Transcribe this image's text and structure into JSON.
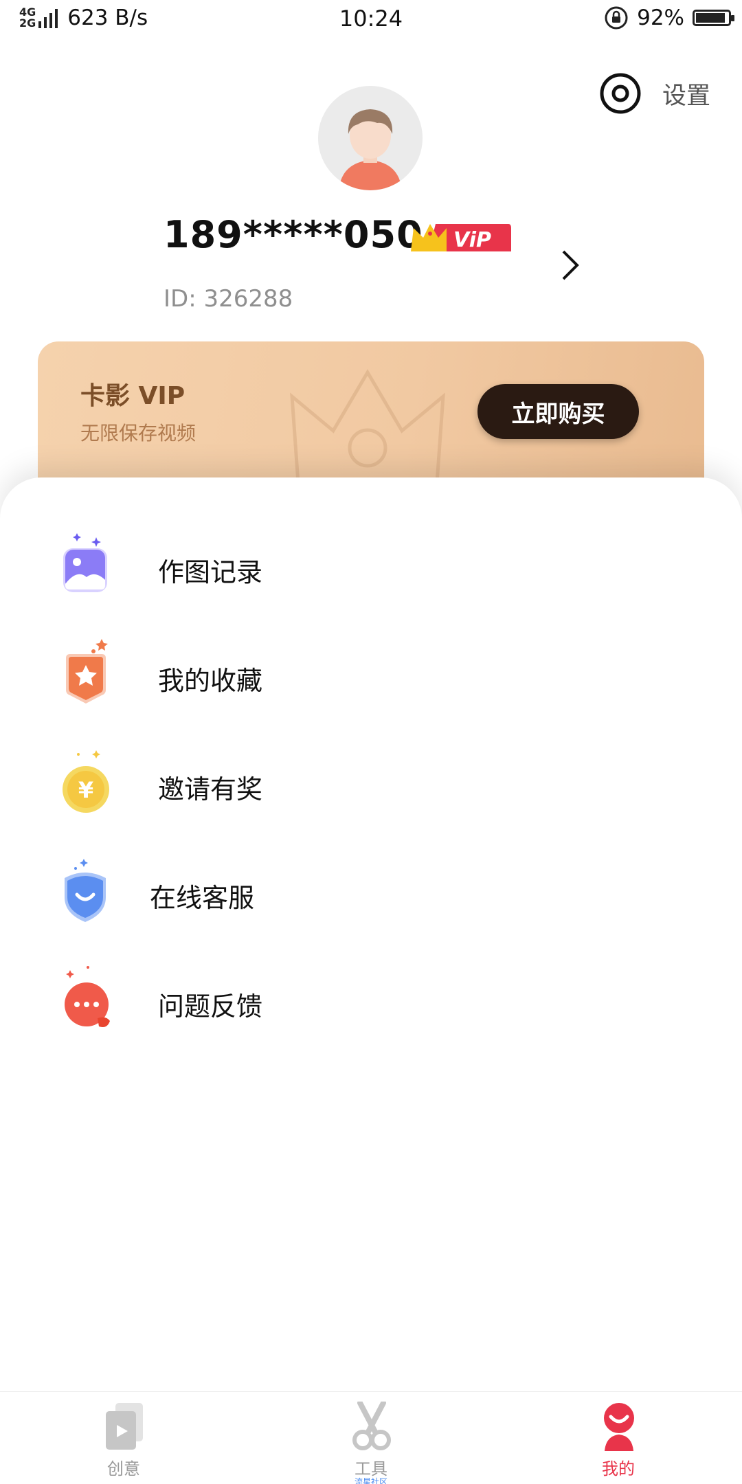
{
  "status_bar": {
    "network_top": "4G",
    "network_bottom": "2G",
    "speed": "623 B/s",
    "time": "10:24",
    "battery_percent": "92%",
    "battery_level": 0.92
  },
  "header": {
    "settings_label": "设置",
    "username": "189*****050",
    "vip_badge_text": "ViP",
    "user_id": "ID: 326288"
  },
  "vip_card": {
    "title": "卡影 VIP",
    "subtitle": "无限保存视频",
    "buy_button": "立即购买"
  },
  "menu": [
    {
      "label": "作图记录",
      "icon": "image-record-icon",
      "color": "#8b7cf6"
    },
    {
      "label": "我的收藏",
      "icon": "favorite-star-icon",
      "color": "#f07a4a"
    },
    {
      "label": "邀请有奖",
      "icon": "yuan-coin-icon",
      "color": "#f5c842"
    },
    {
      "label": "在线客服",
      "icon": "customer-service-icon",
      "color": "#5b8ef0"
    },
    {
      "label": "问题反馈",
      "icon": "feedback-chat-icon",
      "color": "#f05a4a"
    }
  ],
  "bottom_nav": {
    "items": [
      {
        "label": "创意",
        "icon": "creative-play-icon",
        "active": false
      },
      {
        "label": "工具",
        "sublabel": "流星社区",
        "icon": "scissors-icon",
        "active": false
      },
      {
        "label": "我的",
        "icon": "profile-smile-icon",
        "active": true
      }
    ]
  },
  "colors": {
    "accent": "#e8344a",
    "vip_card_bg": "#f1c9a2",
    "buy_button_bg": "#2a1a12"
  }
}
